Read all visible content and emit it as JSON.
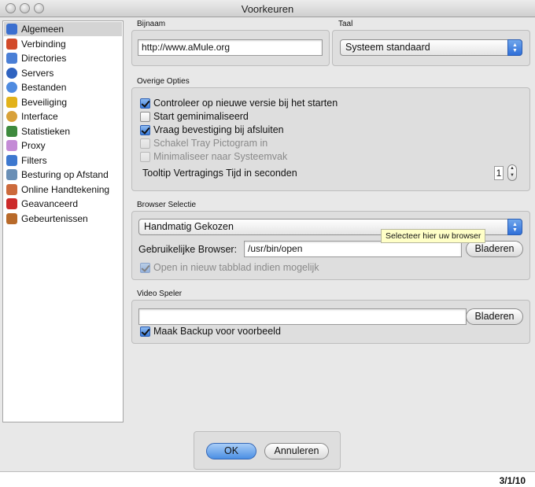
{
  "window": {
    "title": "Voorkeuren"
  },
  "sidebar": {
    "items": [
      {
        "label": "Algemeen",
        "icon": "general-icon",
        "color": "#3b6fcf",
        "selected": true
      },
      {
        "label": "Verbinding",
        "icon": "connection-icon",
        "color": "#d24a2a"
      },
      {
        "label": "Directories",
        "icon": "directories-icon",
        "color": "#4a7fd6"
      },
      {
        "label": "Servers",
        "icon": "servers-icon",
        "color": "#2f63c0"
      },
      {
        "label": "Bestanden",
        "icon": "files-icon",
        "color": "#4f8be0"
      },
      {
        "label": "Beveiliging",
        "icon": "lock-icon",
        "color": "#e2b21a"
      },
      {
        "label": "Interface",
        "icon": "interface-icon",
        "color": "#d8a13a"
      },
      {
        "label": "Statistieken",
        "icon": "statistics-icon",
        "color": "#3e8a3e"
      },
      {
        "label": "Proxy",
        "icon": "proxy-icon",
        "color": "#c48bd6"
      },
      {
        "label": "Filters",
        "icon": "filters-icon",
        "color": "#3d78cf"
      },
      {
        "label": "Besturing op Afstand",
        "icon": "remote-control-icon",
        "color": "#6a8fb6"
      },
      {
        "label": "Online Handtekening",
        "icon": "signature-icon",
        "color": "#cc6a3c"
      },
      {
        "label": "Geavanceerd",
        "icon": "advanced-icon",
        "color": "#cc2a2a"
      },
      {
        "label": "Gebeurtenissen",
        "icon": "events-icon",
        "color": "#b86a2a"
      }
    ]
  },
  "nickname": {
    "label": "Bijnaam",
    "value": "http://www.aMule.org"
  },
  "language": {
    "label": "Taal",
    "value": "Systeem standaard"
  },
  "other_options": {
    "label": "Overige Opties",
    "checks": [
      {
        "label": "Controleer op nieuwe versie bij het starten",
        "checked": true,
        "enabled": true
      },
      {
        "label": "Start geminimaliseerd",
        "checked": false,
        "enabled": true
      },
      {
        "label": "Vraag bevestiging bij afsluiten",
        "checked": true,
        "enabled": true
      },
      {
        "label": "Schakel Tray Pictogram in",
        "checked": false,
        "enabled": false
      },
      {
        "label": "Minimaliseer naar Systeemvak",
        "checked": false,
        "enabled": false
      }
    ],
    "tooltip_delay_label": "Tooltip Vertragings Tijd in seconden",
    "tooltip_delay_value": "1"
  },
  "browser": {
    "label": "Browser Selectie",
    "selection": "Handmatig Gekozen",
    "tooltip": "Selecteer hier uw browser",
    "custom_label": "Gebruikelijke Browser:",
    "custom_value": "/usr/bin/open",
    "browse": "Bladeren",
    "new_tab": "Open in nieuw tabblad indien mogelijk"
  },
  "video": {
    "label": "Video Speler",
    "value": "",
    "browse": "Bladeren",
    "backup": "Maak Backup voor voorbeeld"
  },
  "buttons": {
    "ok": "OK",
    "cancel": "Annuleren"
  },
  "footer": {
    "text": "3/1/10"
  },
  "colors": {
    "accent": "#3b7ddb",
    "selection": "#d4d4d4",
    "tooltip_bg": "#ffffc7"
  }
}
